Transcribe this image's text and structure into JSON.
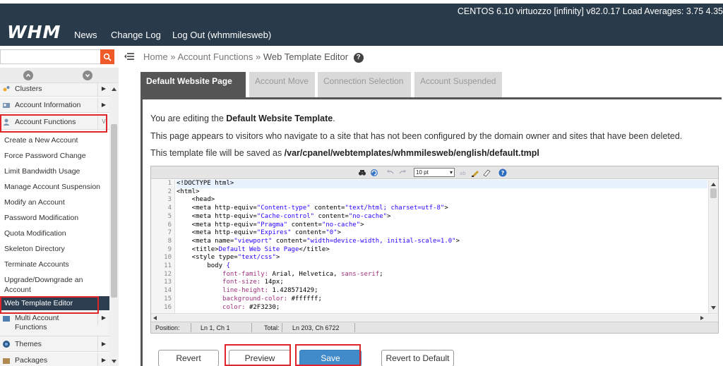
{
  "header": {
    "logo": "WHM",
    "nav": [
      "News",
      "Change Log",
      "Log Out (whmmilesweb)"
    ],
    "server_info": "CENTOS 6.10 virtuozzo [infinity]   v82.0.17   Load Averages: 3.75 4.35"
  },
  "search": {
    "value": "",
    "placeholder": ""
  },
  "sidebar": {
    "categories": {
      "clusters": "Clusters",
      "account_information": "Account Information",
      "account_functions": "Account Functions",
      "multi_account_functions": "Multi Account Functions",
      "themes": "Themes",
      "packages": "Packages"
    },
    "items": [
      "Create a New Account",
      "Force Password Change",
      "Limit Bandwidth Usage",
      "Manage Account Suspension",
      "Modify an Account",
      "Password Modification",
      "Quota Modification",
      "Skeleton Directory",
      "Terminate Accounts",
      "Upgrade/Downgrade an Account",
      "Web Template Editor"
    ]
  },
  "breadcrumb": {
    "home": "Home",
    "sep": "»",
    "section": "Account Functions",
    "current": "Web Template Editor"
  },
  "tabs": [
    "Default Website Page",
    "Account Move",
    "Connection Selection",
    "Account Suspended"
  ],
  "content": {
    "line1_prefix": "You are editing the ",
    "line1_bold": "Default Website Template",
    "line1_suffix": ".",
    "line2": "This page appears to visitors who navigate to a site that has not been configured by the domain owner and sites that have been deleted.",
    "line3_prefix": "This template file will be saved as ",
    "line3_path": "/var/cpanel/webtemplates/whmmilesweb/english/default.tmpl"
  },
  "editor": {
    "font_size": "10 pt",
    "line_numbers": [
      "1",
      "2",
      "3",
      "4",
      "5",
      "6",
      "7",
      "8",
      "9",
      "10",
      "11",
      "12",
      "13",
      "14",
      "15",
      "16"
    ],
    "code": {
      "l1": "<!DOCTYPE html>",
      "l2": "<html>",
      "l3": "    <head>",
      "l4a": "    <meta http-equiv=",
      "l4b": "\"Content-type\"",
      "l4c": " content=",
      "l4d": "\"text/html; charset=utf-8\"",
      "l4e": ">",
      "l5a": "    <meta http-equiv=",
      "l5b": "\"Cache-control\"",
      "l5c": " content=",
      "l5d": "\"no-cache\"",
      "l5e": ">",
      "l6a": "    <meta http-equiv=",
      "l6b": "\"Pragma\"",
      "l6c": " content=",
      "l6d": "\"no-cache\"",
      "l6e": ">",
      "l7a": "    <meta http-equiv=",
      "l7b": "\"Expires\"",
      "l7c": " content=",
      "l7d": "\"0\"",
      "l7e": ">",
      "l8a": "    <meta name=",
      "l8b": "\"viewport\"",
      "l8c": " content=",
      "l8d": "\"width=device-width, initial-scale=1.0\"",
      "l8e": ">",
      "l9a": "    <title>",
      "l9b": "Default Web Site Page",
      "l9c": "</title>",
      "l10a": "    <style type=",
      "l10b": "\"text/css\"",
      "l10c": ">",
      "l11a": "        body ",
      "l11b": "{",
      "l12a": "            font-family: ",
      "l12b": "Arial, Helvetica, ",
      "l12c": "sans-serif",
      "l12d": ";",
      "l13a": "            font-size: ",
      "l13b": "14px",
      "l13c": ";",
      "l14a": "            line-height: ",
      "l14b": "1.428571429",
      "l14c": ";",
      "l15a": "            background-color: ",
      "l15b": "#ffffff",
      "l15c": ";",
      "l16a": "            color: ",
      "l16b": "#2F3230",
      "l16c": ";"
    },
    "status": {
      "position_label": "Position:",
      "position_value": "Ln 1, Ch 1",
      "total_label": "Total:",
      "total_value": "Ln 203, Ch 6722"
    }
  },
  "buttons": {
    "revert": "Revert",
    "preview": "Preview",
    "save": "Save",
    "revert_default": "Revert to Default"
  },
  "colors": {
    "header_bg": "#293a4a",
    "search_btn": "#f05a28",
    "highlight_red": "#e0262b",
    "primary": "#428bca",
    "active_tab": "#555555"
  }
}
